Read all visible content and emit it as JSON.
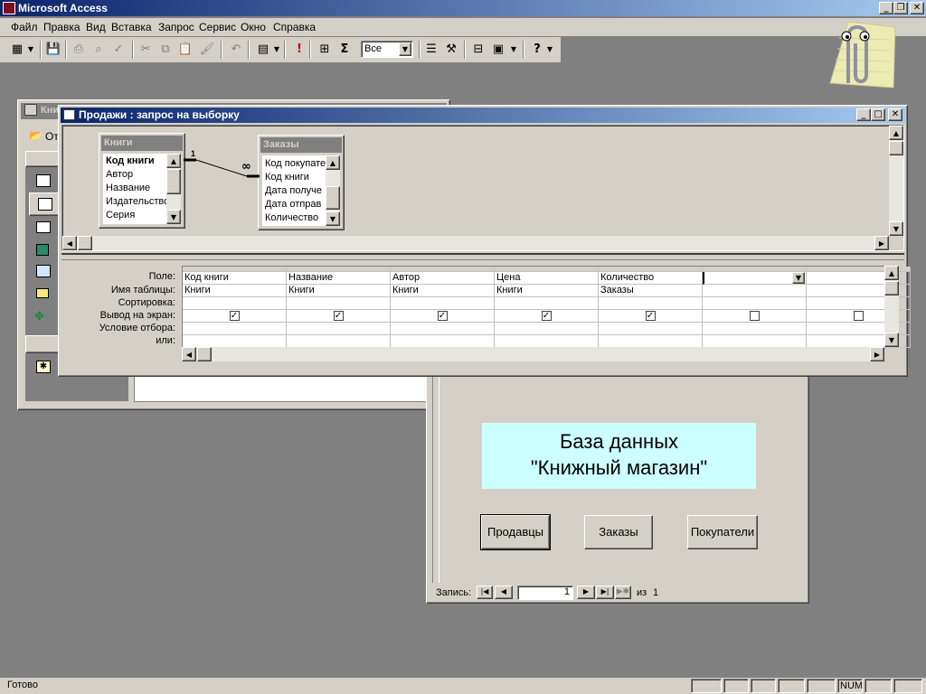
{
  "app": {
    "title": "Microsoft Access"
  },
  "menu": [
    "Файл",
    "Правка",
    "Вид",
    "Вставка",
    "Запрос",
    "Сервис",
    "Окно",
    "Справка"
  ],
  "toolbar": {
    "filter_value": "Все"
  },
  "db_window": {
    "title": "Кни",
    "open_label": "От"
  },
  "query_window": {
    "title": "Продажи : запрос на выборку"
  },
  "tables": [
    {
      "name": "Книги",
      "fields": [
        "Код книги",
        "Автор",
        "Название",
        "Издательство",
        "Серия"
      ]
    },
    {
      "name": "Заказы",
      "fields": [
        "Код покупате",
        "Код книги",
        "Дата получе",
        "Дата отправ",
        "Количество"
      ]
    }
  ],
  "relation": {
    "one": "1",
    "many": "∞"
  },
  "grid": {
    "row_labels": [
      "Поле:",
      "Имя таблицы:",
      "Сортировка:",
      "Вывод на экран:",
      "Условие отбора:",
      "или:"
    ],
    "columns": [
      {
        "field": "Код книги",
        "table": "Книги",
        "show": true
      },
      {
        "field": "Название",
        "table": "Книги",
        "show": true
      },
      {
        "field": "Автор",
        "table": "Книги",
        "show": true
      },
      {
        "field": "Цена",
        "table": "Книги",
        "show": true
      },
      {
        "field": "Количество",
        "table": "Заказы",
        "show": true
      },
      {
        "field": "",
        "table": "",
        "show": false
      },
      {
        "field": "",
        "table": "",
        "show": false
      }
    ]
  },
  "form": {
    "banner_line1": "База данных",
    "banner_line2": "\"Книжный магазин\"",
    "buttons": [
      "Продавцы",
      "Заказы",
      "Покупатели"
    ],
    "record_label": "Запись:",
    "record_value": "1",
    "record_of": "из",
    "record_total": "1"
  },
  "status": {
    "text": "Готово",
    "num": "NUM"
  }
}
